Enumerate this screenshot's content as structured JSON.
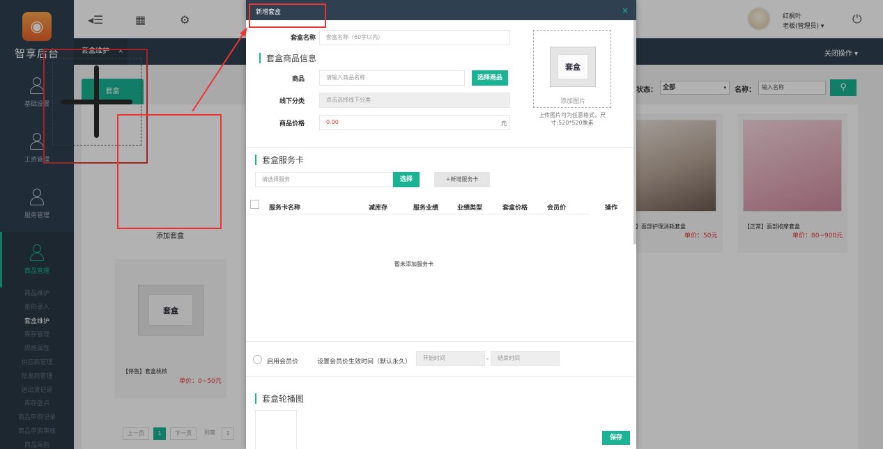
{
  "sidebar": {
    "logo_text": "智享后台",
    "items": [
      {
        "label": "基础设置"
      },
      {
        "label": "工资管理"
      },
      {
        "label": "服务管理"
      },
      {
        "label": "商品管理"
      }
    ],
    "sub_items": [
      "商品维护",
      "条码录入",
      "套盒维护",
      "库存管理",
      "规格属性",
      "供应商管理",
      "批发商管理",
      "进出货记录",
      "库存盘点",
      "商品申购记录",
      "商品申购审核",
      "商品采购"
    ]
  },
  "topbar": {
    "user_name": "红枫叶",
    "user_role": "老板(管理员) ▾"
  },
  "tabbar": {
    "tab_label": "套盒维护",
    "tab_close": "×",
    "close_ops": "关闭操作 ▾"
  },
  "content": {
    "green_tab": "套盒",
    "add_label": "添加套盒",
    "status_label": "状态：",
    "status_value": "全部",
    "name_label": "名称：",
    "name_placeholder": "输入名称",
    "cards": [
      {
        "title": "【停售】套盒桃核",
        "price": "单价：0~50元",
        "thumb": "套盒"
      },
      {
        "title": "】面部护理消耗套盒",
        "price": "单价：50元"
      },
      {
        "title": "【正常】面部按摩套盒",
        "price": "单价：80~900元"
      }
    ],
    "pager": [
      "上一页",
      "1",
      "下一页",
      "到第",
      "1"
    ]
  },
  "modal": {
    "title": "新增套盒",
    "close": "×",
    "name_label": "套盒名称",
    "name_placeholder": "套盒名称（60字以内）",
    "section_goods": "套盒商品信息",
    "goods_label": "商品",
    "goods_placeholder": "请输入商品名称",
    "select_goods_btn": "选择商品",
    "offline_label": "线下分类",
    "offline_placeholder": "点击选择线下分类",
    "price_label": "商品价格",
    "price_value": "0.00",
    "price_unit": "元",
    "image_thumb": "套盒",
    "add_image": "添加图片",
    "image_hint": "上传图片可为任意格式，尺寸:520*520像素",
    "section_service": "套盒服务卡",
    "service_placeholder": "请选择服务",
    "select_btn": "选择",
    "add_service_btn": "+新增服务卡",
    "table_headers": [
      "服务卡名称",
      "减库存",
      "服务业绩",
      "业绩类型",
      "套盒价格",
      "会员价",
      "操作"
    ],
    "empty_text": "暂未添加服务卡",
    "member_label": "启用会员价",
    "member_time_label": "设置会员价生效时间（默认永久）",
    "start_placeholder": "开始时间",
    "dash": "-",
    "end_placeholder": "结束时间",
    "section_carousel": "套盒轮播图",
    "save_btn": "保存"
  },
  "colors": {
    "accent": "#1ab394",
    "sidebar": "#2f4050",
    "annotation": "#ee3333"
  }
}
